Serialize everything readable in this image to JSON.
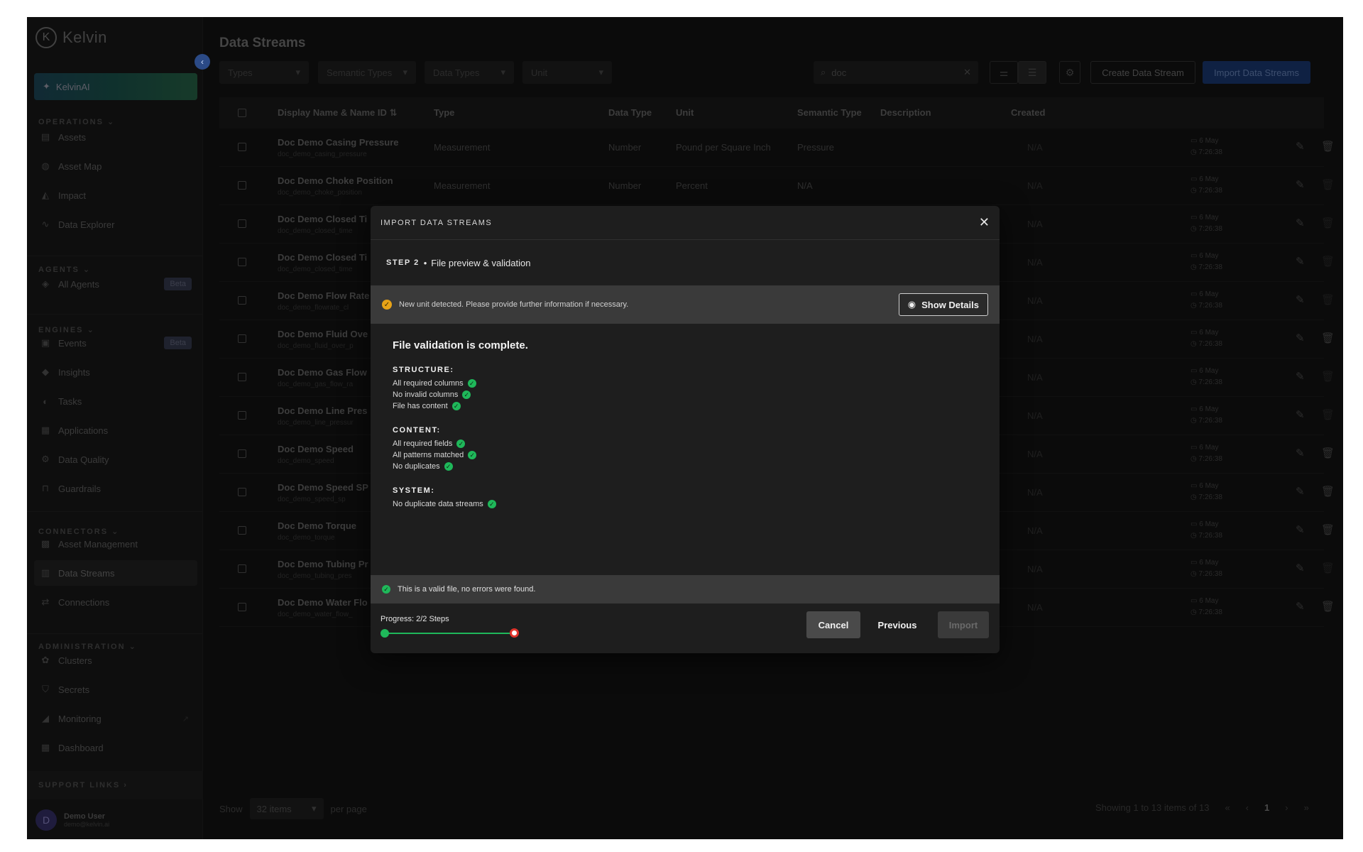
{
  "app": {
    "logo_text": "Kelvin"
  },
  "sidebar": {
    "kelvin_ai": "KelvinAI",
    "sections": {
      "operations": "OPERATIONS",
      "agents": "AGENTS",
      "engines": "ENGINES",
      "connectors": "CONNECTORS",
      "administration": "ADMINISTRATION",
      "support": "SUPPORT LINKS"
    },
    "items": {
      "assets": "Assets",
      "asset_map": "Asset Map",
      "impact": "Impact",
      "data_explorer": "Data Explorer",
      "all_agents": "All Agents",
      "events": "Events",
      "insights": "Insights",
      "tasks": "Tasks",
      "applications": "Applications",
      "data_quality": "Data Quality",
      "guardrails": "Guardrails",
      "asset_management": "Asset Management",
      "data_streams": "Data Streams",
      "connections": "Connections",
      "clusters": "Clusters",
      "secrets": "Secrets",
      "monitoring": "Monitoring",
      "dashboard": "Dashboard"
    },
    "beta": "Beta",
    "user": {
      "initial": "D",
      "name": "Demo User",
      "email": "demo@kelvin.ai"
    }
  },
  "page": {
    "title": "Data Streams",
    "filters": [
      "Types",
      "Semantic Types",
      "Data Types",
      "Unit"
    ],
    "search_value": "doc",
    "create_button": "Create Data Stream",
    "import_button": "Import Data Streams"
  },
  "table": {
    "columns": [
      "Display Name & Name ID",
      "Type",
      "Data Type",
      "Unit",
      "Semantic Type",
      "Description",
      "Created"
    ],
    "rows": [
      {
        "name": "Doc Demo Casing Pressure",
        "id": "doc_demo_casing_pressure",
        "type": "Measurement",
        "data_type": "Number",
        "unit": "Pound per Square Inch",
        "semantic": "Pressure",
        "desc": "N/A",
        "date": "6 May",
        "time": "7:26:38"
      },
      {
        "name": "Doc Demo Choke Position",
        "id": "doc_demo_choke_position",
        "type": "Measurement",
        "data_type": "Number",
        "unit": "Percent",
        "semantic": "N/A",
        "desc": "N/A",
        "date": "6 May",
        "time": "7:26:38"
      },
      {
        "name": "Doc Demo Closed Ti",
        "id": "doc_demo_closed_time",
        "desc": "N/A",
        "date": "6 May",
        "time": "7:26:38"
      },
      {
        "name": "Doc Demo Closed Ti",
        "id": "doc_demo_closed_time",
        "desc": "N/A",
        "date": "6 May",
        "time": "7:26:38"
      },
      {
        "name": "Doc Demo Flow Rate",
        "id": "doc_demo_flowrate_cl",
        "desc": "N/A",
        "date": "6 May",
        "time": "7:26:38"
      },
      {
        "name": "Doc Demo Fluid Ove",
        "id": "doc_demo_fluid_over_p",
        "desc": "N/A",
        "date": "6 May",
        "time": "7:26:38"
      },
      {
        "name": "Doc Demo Gas Flow",
        "id": "doc_demo_gas_flow_ra",
        "desc": "N/A",
        "date": "6 May",
        "time": "7:26:38"
      },
      {
        "name": "Doc Demo Line Pres",
        "id": "doc_demo_line_pressur",
        "desc": "N/A",
        "date": "6 May",
        "time": "7:26:38"
      },
      {
        "name": "Doc Demo Speed",
        "id": "doc_demo_speed",
        "desc": "N/A",
        "date": "6 May",
        "time": "7:26:38"
      },
      {
        "name": "Doc Demo Speed SP",
        "id": "doc_demo_speed_sp",
        "desc": "N/A",
        "date": "6 May",
        "time": "7:26:38"
      },
      {
        "name": "Doc Demo Torque",
        "id": "doc_demo_torque",
        "desc": "N/A",
        "date": "6 May",
        "time": "7:26:38"
      },
      {
        "name": "Doc Demo Tubing Pr",
        "id": "doc_demo_tubing_pres",
        "desc": "N/A",
        "date": "6 May",
        "time": "7:26:38"
      },
      {
        "name": "Doc Demo Water Flo",
        "id": "doc_demo_water_flow_",
        "desc": "N/A",
        "date": "6 May",
        "time": "7:26:38"
      }
    ]
  },
  "pagination": {
    "show": "Show",
    "per_page_value": "32 items",
    "per_page": "per page",
    "summary": "Showing 1 to 13 items of 13",
    "current": "1"
  },
  "modal": {
    "title": "IMPORT DATA STREAMS",
    "step_label": "STEP 2",
    "step_name": "File preview & validation",
    "warning": "New unit detected. Please provide further information if necessary.",
    "show_details": "Show Details",
    "heading": "File validation is complete.",
    "groups": {
      "structure": {
        "title": "STRUCTURE:",
        "items": [
          "All required columns",
          "No invalid columns",
          "File has content"
        ]
      },
      "content": {
        "title": "CONTENT:",
        "items": [
          "All required fields",
          "All patterns matched",
          "No duplicates"
        ]
      },
      "system": {
        "title": "SYSTEM:",
        "items": [
          "No duplicate data streams"
        ]
      }
    },
    "valid_message": "This is a valid file, no errors were found.",
    "progress_label": "Progress: 2/2 Steps",
    "progress": 1.0,
    "cancel": "Cancel",
    "previous": "Previous",
    "import": "Import"
  },
  "colors": {
    "accent_green": "#1fb85a",
    "warning": "#e8a317",
    "progress_end": "#e0342b",
    "primary": "#1c3d7a"
  }
}
